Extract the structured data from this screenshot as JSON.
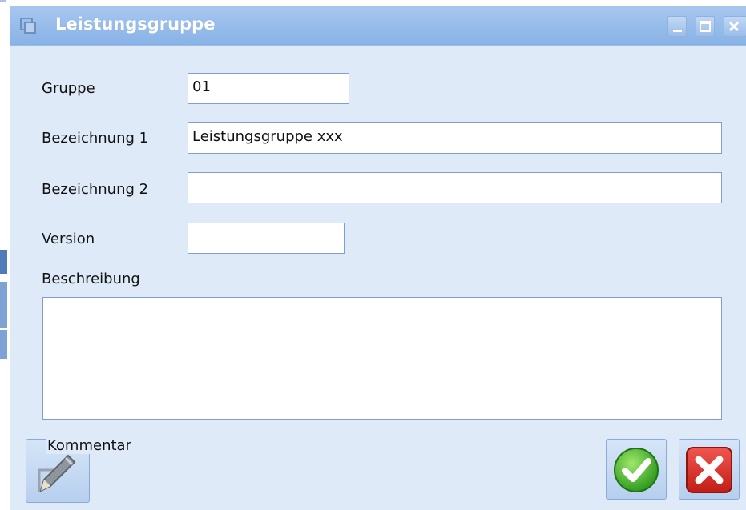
{
  "window": {
    "title": "Leistungsgruppe",
    "titlebar_color": "#88b2e6",
    "background_color": "#dfeaf8"
  },
  "form": {
    "gruppe": {
      "label": "Gruppe",
      "value": "01"
    },
    "bezeichnung1": {
      "label": "Bezeichnung 1",
      "value": "Leistungsgruppe xxx"
    },
    "bezeichnung2": {
      "label": "Bezeichnung 2",
      "value": ""
    },
    "version": {
      "label": "Version",
      "value": ""
    },
    "beschreibung": {
      "label": "Beschreibung",
      "value": ""
    }
  },
  "buttons": {
    "comment_label": "Kommentar",
    "comment_icon": "pencil-icon",
    "ok_icon": "checkmark-icon",
    "cancel_icon": "x-icon"
  }
}
